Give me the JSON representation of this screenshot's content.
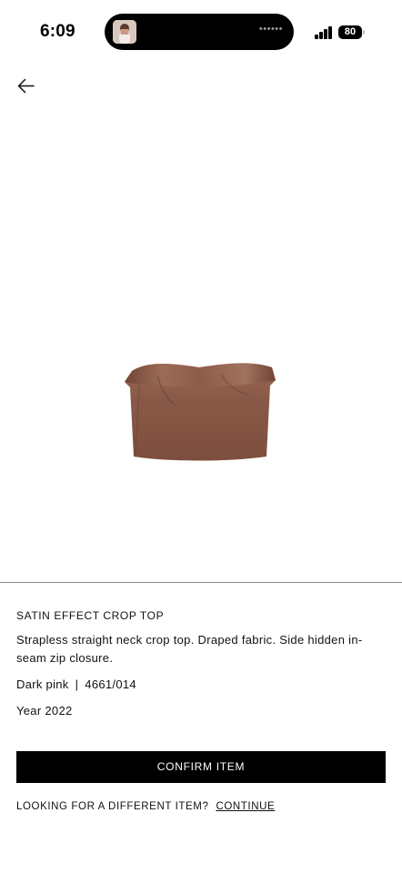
{
  "status_bar": {
    "time": "6:09",
    "battery_percent": "80",
    "island_dots": "••••••",
    "icons": [
      "signal-icon",
      "battery-icon",
      "island-thumbnail-icon"
    ]
  },
  "header": {
    "back_icon": "arrow-left-icon"
  },
  "product": {
    "image_color": "#8a5a48",
    "title": "SATIN EFFECT CROP TOP",
    "description": "Strapless straight neck crop top. Draped fabric. Side hidden in-seam zip closure.",
    "color_name": "Dark pink",
    "separator": "|",
    "reference": "4661/014",
    "year": "Year 2022"
  },
  "actions": {
    "confirm_label": "CONFIRM ITEM",
    "alt_prompt": "LOOKING FOR A DIFFERENT ITEM?",
    "continue_label": "CONTINUE"
  }
}
